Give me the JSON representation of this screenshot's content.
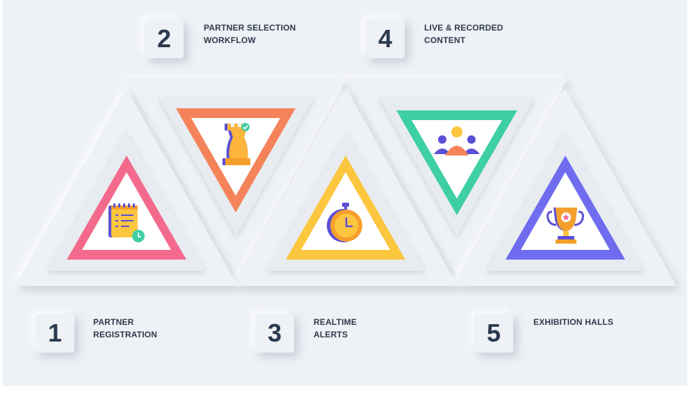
{
  "steps": [
    {
      "number": "1",
      "line1": "PARTNER",
      "line2": "REGISTRATION",
      "color": "#f36a8c",
      "icon": "checklist-icon"
    },
    {
      "number": "2",
      "line1": "PARTNER SELECTION",
      "line2": "WORKFLOW",
      "color": "#f5835a",
      "icon": "chess-rook-icon"
    },
    {
      "number": "3",
      "line1": "REALTIME",
      "line2": "ALERTS",
      "color": "#fcc63f",
      "icon": "stopwatch-icon"
    },
    {
      "number": "4",
      "line1": "LIVE & RECORDED",
      "line2": "CONTENT",
      "color": "#3fcfa4",
      "icon": "people-group-icon"
    },
    {
      "number": "5",
      "line1": "EXHIBITION HALLS",
      "line2": "",
      "color": "#6f6cf0",
      "icon": "trophy-icon"
    }
  ],
  "colors": {
    "background": "#eef1f5",
    "text": "#2e3a4c"
  }
}
